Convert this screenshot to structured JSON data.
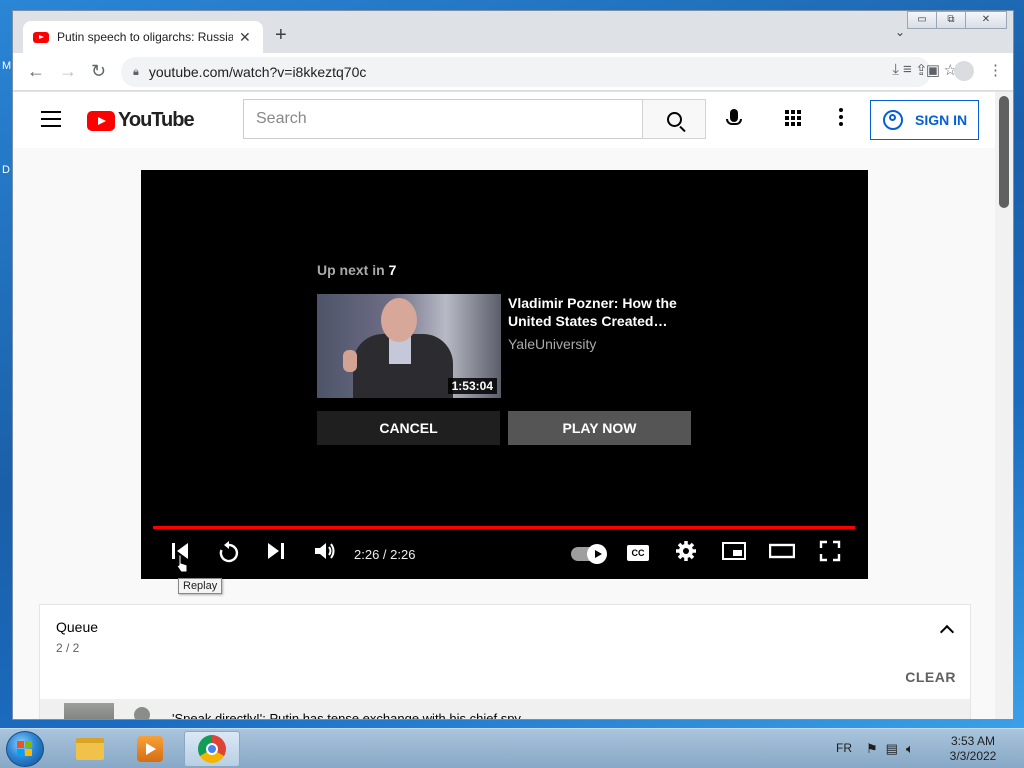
{
  "browser": {
    "tab_title": "Putin speech to oligarchs: Russia",
    "tab_close": "✕",
    "new_tab": "+",
    "tab_list": "⌄",
    "url": "youtube.com/watch?v=i8kkeztq70c",
    "win_minimize": "▭",
    "win_restore": "⧉",
    "win_close": "✕"
  },
  "youtube": {
    "logo_text": "YouTube",
    "search_placeholder": "Search",
    "sign_in": "SIGN IN"
  },
  "player": {
    "up_next_prefix": "Up next in ",
    "up_next_seconds": "7",
    "next_title": "Vladimir Pozner: How the United States Created…",
    "next_channel": "YaleUniversity",
    "next_duration": "1:53:04",
    "cancel_label": "CANCEL",
    "play_now_label": "PLAY NOW",
    "time_display": "2:26 / 2:26",
    "progress_fraction": 1.0,
    "cc_label": "CC",
    "tooltip": "Replay"
  },
  "queue": {
    "title": "Queue",
    "count": "2 / 2",
    "clear_label": "CLEAR",
    "item_title": "'Speak directly!': Putin has tense exchange with his chief spy"
  },
  "desktop": {
    "glyph_1": "M",
    "glyph_2": "D"
  },
  "taskbar": {
    "language": "FR",
    "time": "3:53 AM",
    "date": "3/3/2022"
  },
  "colors": {
    "youtube_red": "#ff0000",
    "sign_in_blue": "#065fd4",
    "player_bg": "#000000"
  }
}
